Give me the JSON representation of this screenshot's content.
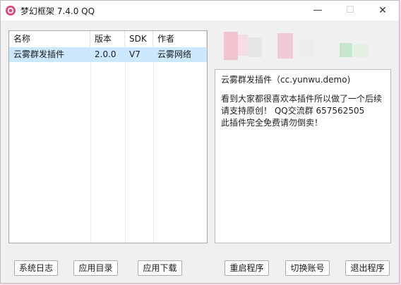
{
  "window": {
    "title": "梦幻框架 7.4.0 QQ",
    "controls": {
      "minimize": "—",
      "maximize": "☐",
      "close": "✕"
    }
  },
  "plugin_list": {
    "columns": [
      "名称",
      "版本",
      "SDK",
      "作者"
    ],
    "rows": [
      {
        "name": "云雾群发插件",
        "version": "2.0.0",
        "sdk": "V7",
        "author": "云雾网络",
        "selected": true
      }
    ]
  },
  "description": {
    "title": "云雾群发插件（cc.yunwu.demo)",
    "lines": [
      "看到大家都很喜欢本插件所以做了一个后续",
      "请支持原创！ QQ交流群 657562505",
      "此插件完全免费请勿倒卖！"
    ]
  },
  "buttons": {
    "system_log": "系统日志",
    "app_dir": "应用目录",
    "app_download": "应用下载",
    "restart": "重启程序",
    "switch_account": "切换账号",
    "exit": "退出程序"
  },
  "colors": {
    "selection": "#cce8ff",
    "window_bg": "#f0f0f0",
    "app_icon": "#e0457b"
  },
  "icons": {
    "app": "app-logo-icon"
  }
}
